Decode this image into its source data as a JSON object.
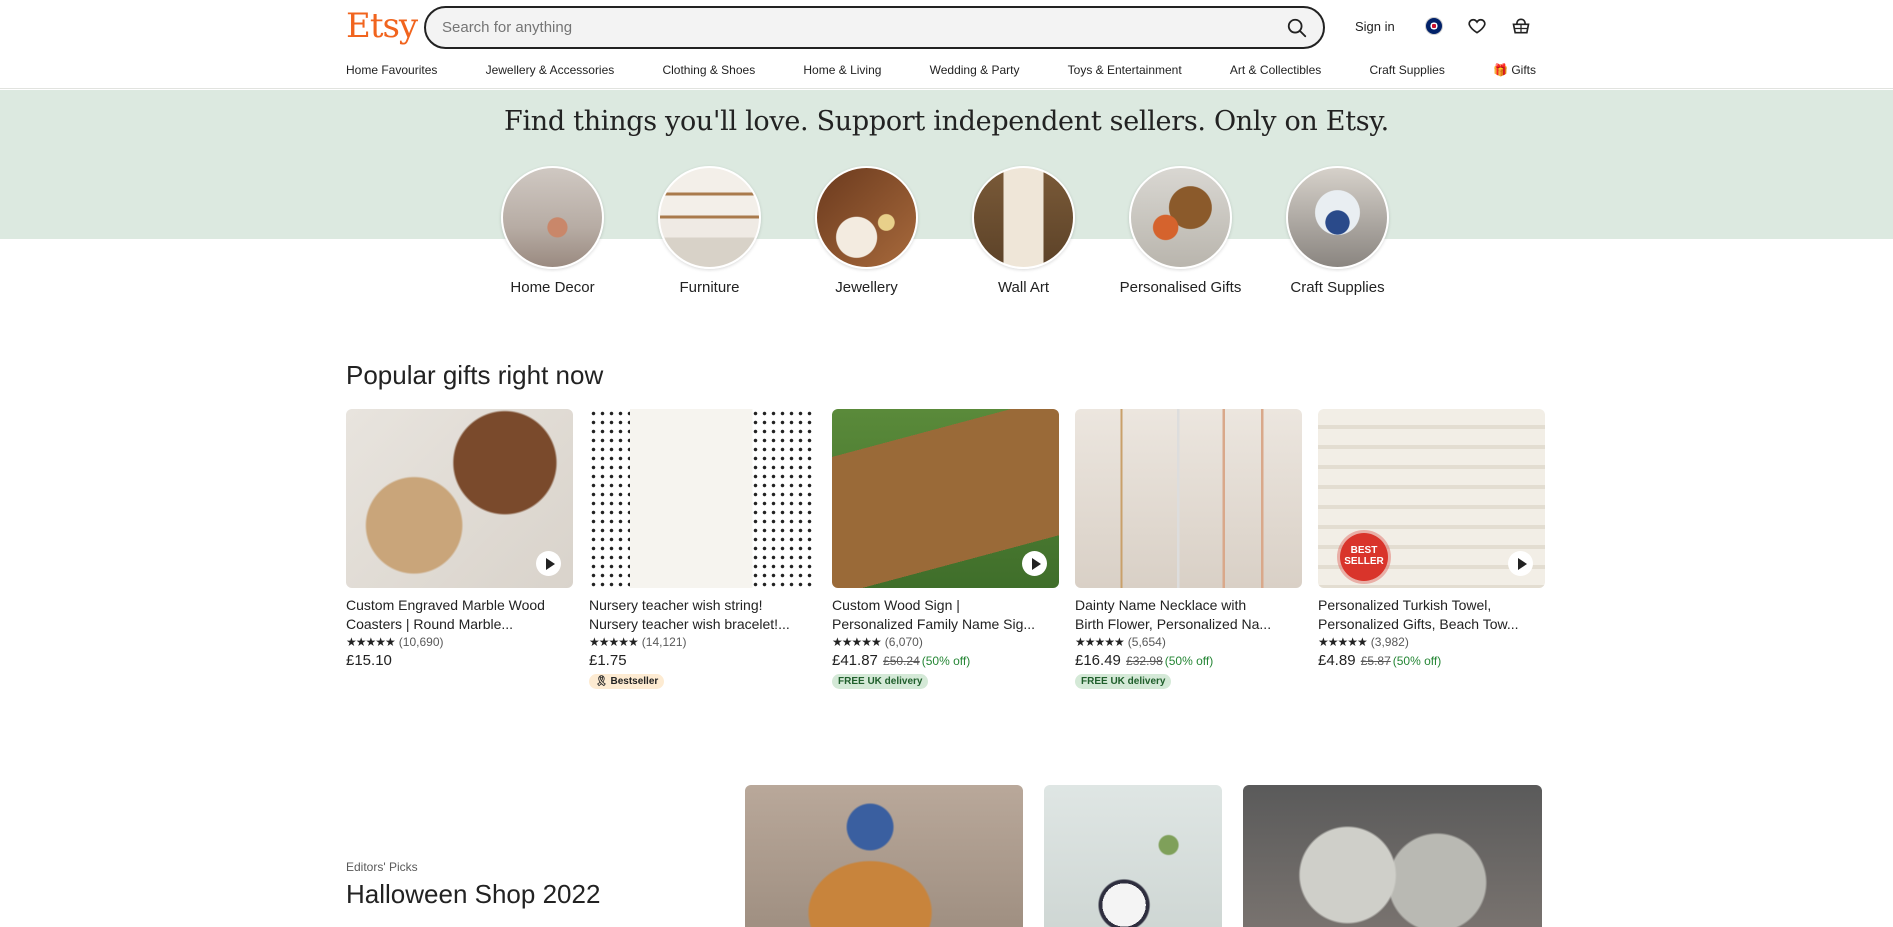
{
  "header": {
    "logo": "Etsy",
    "search_placeholder": "Search for anything",
    "sign_in": "Sign in"
  },
  "nav": [
    "Home Favourites",
    "Jewellery & Accessories",
    "Clothing & Shoes",
    "Home & Living",
    "Wedding & Party",
    "Toys & Entertainment",
    "Art & Collectibles",
    "Craft Supplies",
    "Gifts"
  ],
  "hero": {
    "title": "Find things you'll love. Support independent sellers. Only on Etsy."
  },
  "categories": [
    {
      "label": "Home Decor"
    },
    {
      "label": "Furniture"
    },
    {
      "label": "Jewellery"
    },
    {
      "label": "Wall Art"
    },
    {
      "label": "Personalised Gifts"
    },
    {
      "label": "Craft Supplies"
    }
  ],
  "popular": {
    "title": "Popular gifts right now",
    "products": [
      {
        "title1": "Custom Engraved Marble Wood",
        "title2": "Coasters | Round Marble...",
        "reviews": "(10,690)",
        "price": "£15.10",
        "original": "",
        "discount": "",
        "badge": ""
      },
      {
        "title1": "Nursery teacher wish string!",
        "title2": "Nursery teacher wish bracelet!...",
        "reviews": "(14,121)",
        "price": "£1.75",
        "original": "",
        "discount": "",
        "badge": "Bestseller"
      },
      {
        "title1": "Custom Wood Sign |",
        "title2": "Personalized Family Name Sig...",
        "reviews": "(6,070)",
        "price": "£41.87",
        "original": "£50.24",
        "discount": "(50% off)",
        "badge": "FREE UK delivery"
      },
      {
        "title1": "Dainty Name Necklace with",
        "title2": "Birth Flower, Personalized Na...",
        "reviews": "(5,654)",
        "price": "£16.49",
        "original": "£32.98",
        "discount": "(50% off)",
        "badge": "FREE UK delivery"
      },
      {
        "title1": "Personalized Turkish Towel,",
        "title2": "Personalized Gifts, Beach Tow...",
        "reviews": "(3,982)",
        "price": "£4.89",
        "original": "£5.87",
        "discount": "(50% off)",
        "badge": ""
      }
    ],
    "stars": "★★★★★",
    "best_seal": "BEST SELLER"
  },
  "editors": {
    "kicker": "Editors' Picks",
    "title": "Halloween Shop 2022"
  }
}
